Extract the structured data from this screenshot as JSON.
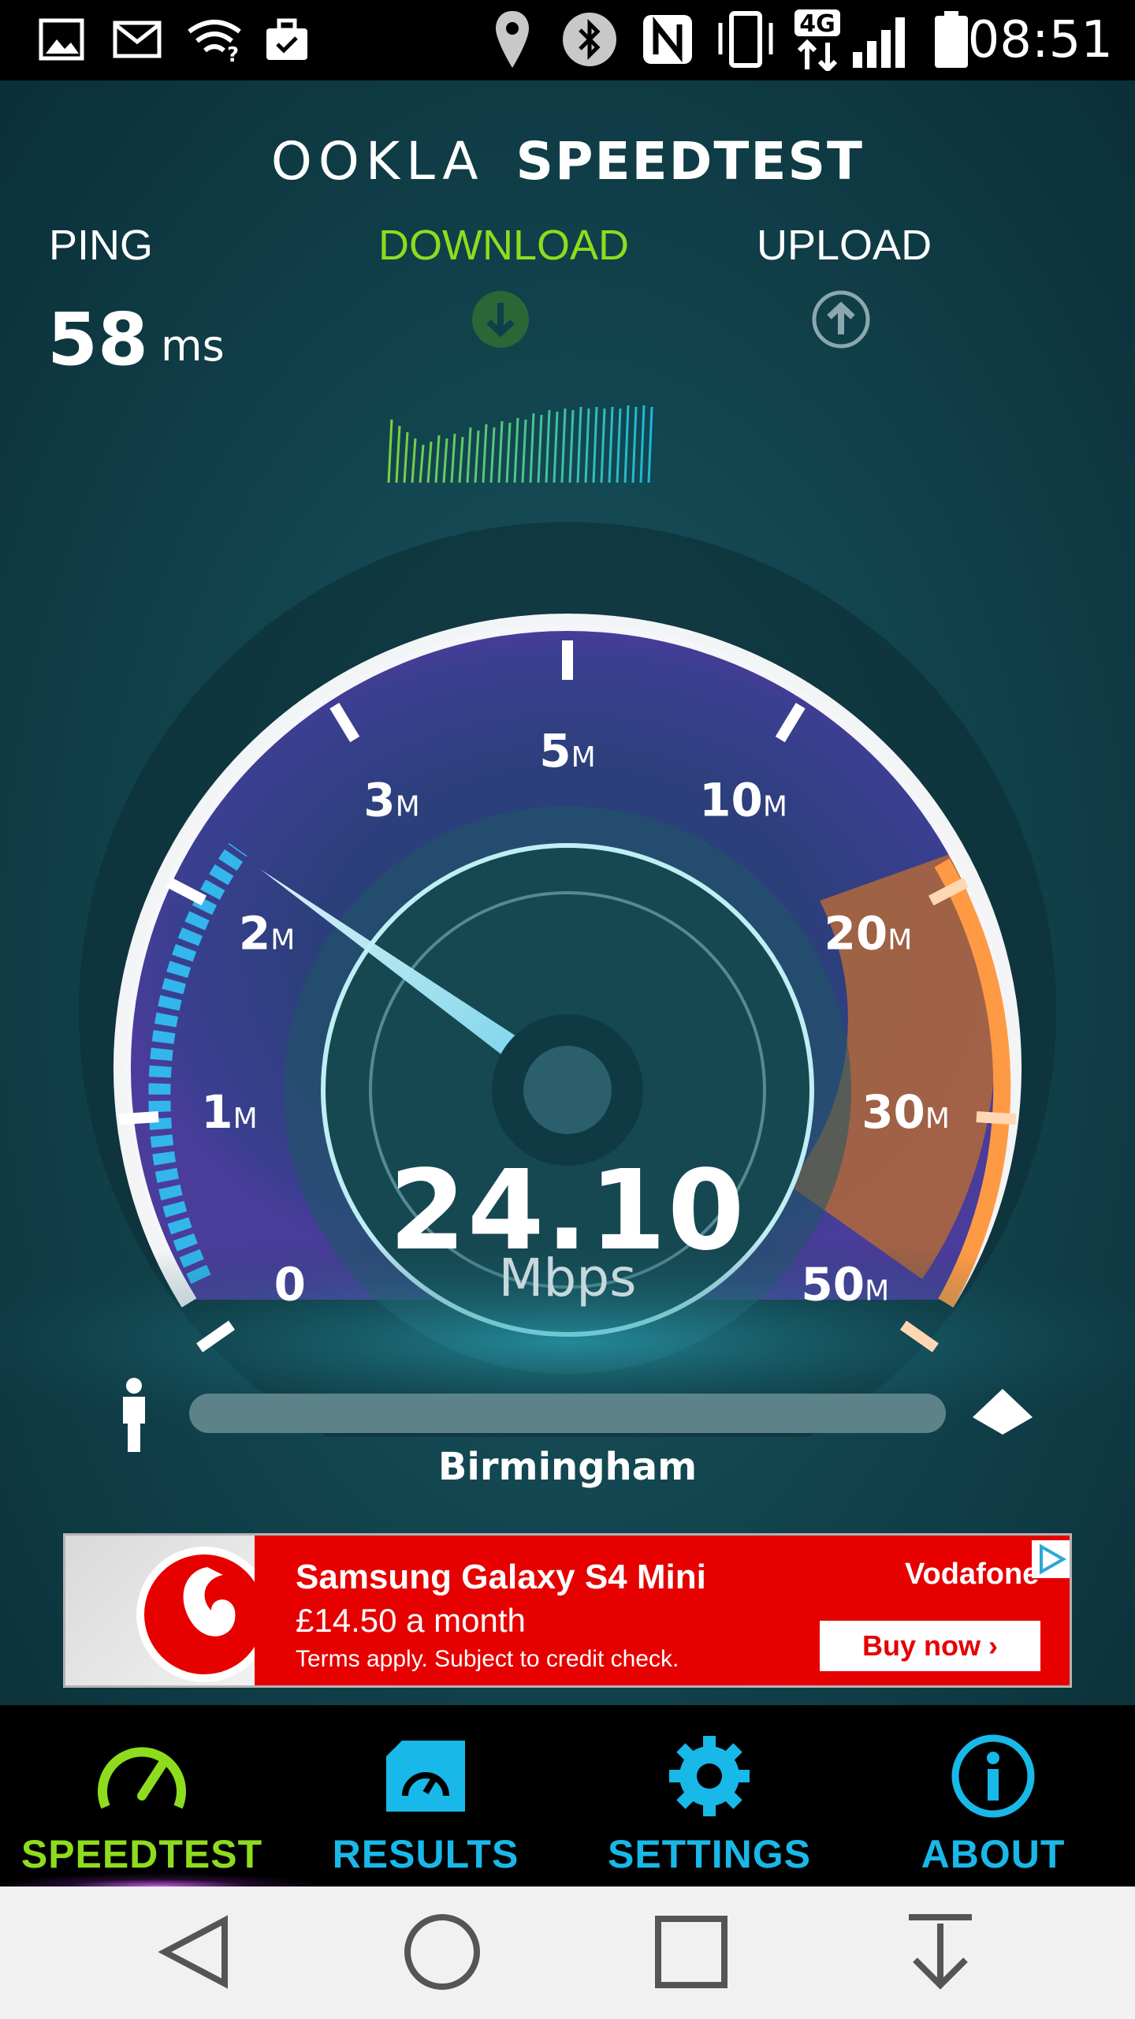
{
  "status_bar": {
    "time": "08:51",
    "network": "4G",
    "icons": [
      "gallery-icon",
      "gmail-icon",
      "wifi-question-icon",
      "briefcase-icon",
      "location-icon",
      "bluetooth-icon",
      "nfc-icon",
      "vibrate-icon",
      "network-4g-icon",
      "signal-icon",
      "battery-icon"
    ]
  },
  "app": {
    "brand": "OOKLA",
    "product": "SPEEDTEST"
  },
  "metrics": {
    "ping_label": "PING",
    "ping_value": "58",
    "ping_unit": "ms",
    "download_label": "DOWNLOAD",
    "upload_label": "UPLOAD"
  },
  "gauge": {
    "ticks": [
      "0",
      "1",
      "2",
      "3",
      "5",
      "10",
      "20",
      "30",
      "50"
    ],
    "unit_suffix": "M",
    "speed_value": "24.10",
    "speed_unit": "Mbps"
  },
  "server": {
    "name": "Birmingham"
  },
  "ad": {
    "headline": "Samsung Galaxy S4 Mini",
    "price": "£14.50 a month",
    "terms": "Terms apply. Subject to credit check.",
    "brand": "Vodafone",
    "cta": "Buy now ›"
  },
  "tabs": [
    {
      "label": "SPEEDTEST",
      "icon": "speedometer-icon",
      "active": true
    },
    {
      "label": "RESULTS",
      "icon": "results-folder-icon",
      "active": false
    },
    {
      "label": "SETTINGS",
      "icon": "gear-icon",
      "active": false
    },
    {
      "label": "ABOUT",
      "icon": "info-icon",
      "active": false
    }
  ],
  "colors": {
    "accent_green": "#8edc1e",
    "tab_blue": "#18b8e8",
    "ad_red": "#e60000",
    "gauge_orange": "#f08a3c"
  },
  "nav": [
    "back-icon",
    "home-icon",
    "recents-icon",
    "notification-pull-icon"
  ]
}
